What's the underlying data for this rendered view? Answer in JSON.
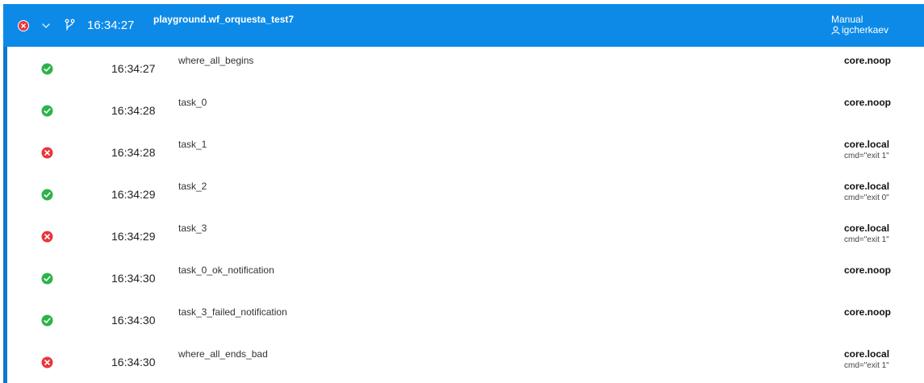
{
  "header": {
    "status": "failed",
    "time": "16:34:27",
    "title": "playground.wf_orquesta_test7",
    "trigger": "Manual",
    "user": "igcherkaev"
  },
  "colors": {
    "header_bg": "#0d8ae8",
    "accent": "#0d78d0",
    "succeeded": "#2cb34a",
    "failed": "#e8363c"
  },
  "tasks": [
    {
      "status": "succeeded",
      "time": "16:34:27",
      "name": "where_all_begins",
      "action": "core.noop",
      "params": ""
    },
    {
      "status": "succeeded",
      "time": "16:34:28",
      "name": "task_0",
      "action": "core.noop",
      "params": ""
    },
    {
      "status": "failed",
      "time": "16:34:28",
      "name": "task_1",
      "action": "core.local",
      "params": "cmd=\"exit 1\""
    },
    {
      "status": "succeeded",
      "time": "16:34:29",
      "name": "task_2",
      "action": "core.local",
      "params": "cmd=\"exit 0\""
    },
    {
      "status": "failed",
      "time": "16:34:29",
      "name": "task_3",
      "action": "core.local",
      "params": "cmd=\"exit 1\""
    },
    {
      "status": "succeeded",
      "time": "16:34:30",
      "name": "task_0_ok_notification",
      "action": "core.noop",
      "params": ""
    },
    {
      "status": "succeeded",
      "time": "16:34:30",
      "name": "task_3_failed_notification",
      "action": "core.noop",
      "params": ""
    },
    {
      "status": "failed",
      "time": "16:34:30",
      "name": "where_all_ends_bad",
      "action": "core.local",
      "params": "cmd=\"exit 1\""
    }
  ]
}
